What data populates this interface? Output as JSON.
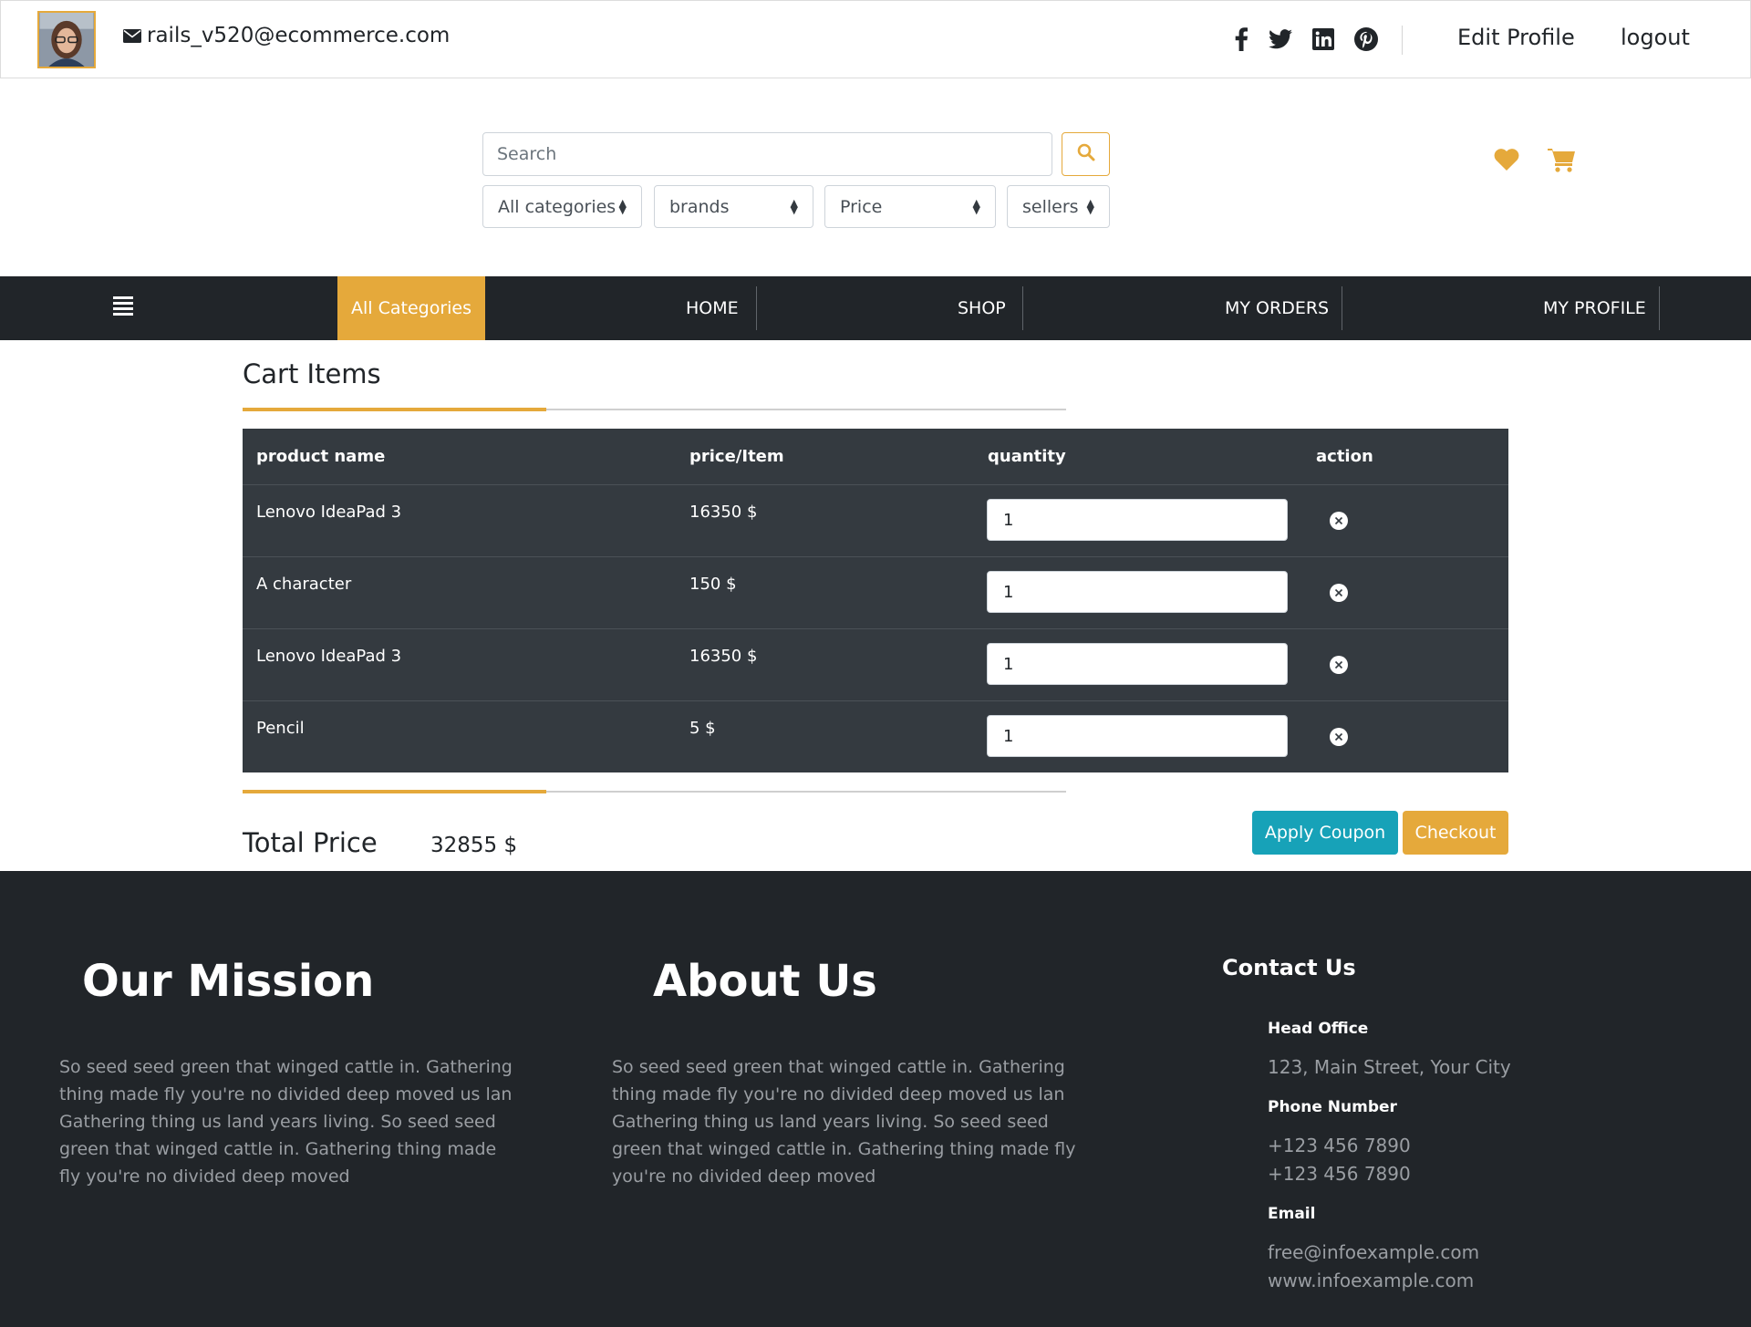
{
  "header": {
    "email": "rails_v520@ecommerce.com",
    "social_icons": [
      "facebook-icon",
      "twitter-icon",
      "linkedin-icon",
      "pinterest-icon"
    ],
    "edit_profile": "Edit Profile",
    "logout": "logout"
  },
  "search": {
    "placeholder": "Search",
    "filters": {
      "category": "All categories",
      "brand": "brands",
      "price": "Price",
      "seller": "sellers"
    }
  },
  "nav": {
    "all_categories": "All Categories",
    "items": [
      "HOME",
      "SHOP",
      "MY ORDERS",
      "MY PROFILE"
    ]
  },
  "cart": {
    "title": "Cart Items",
    "columns": [
      "product name",
      "price/Item",
      "quantity",
      "action"
    ],
    "rows": [
      {
        "name": "Lenovo IdeaPad 3",
        "price": "16350 $",
        "quantity": "1"
      },
      {
        "name": "A character",
        "price": "150 $",
        "quantity": "1"
      },
      {
        "name": "Lenovo IdeaPad 3",
        "price": "16350 $",
        "quantity": "1"
      },
      {
        "name": "Pencil",
        "price": "5 $",
        "quantity": "1"
      }
    ],
    "total_label": "Total Price",
    "total_value": "32855 $",
    "apply_coupon": "Apply Coupon",
    "checkout": "Checkout"
  },
  "footer": {
    "mission_title": "Our Mission",
    "mission_text": "So seed seed green that winged cattle in. Gathering thing made fly you're no divided deep moved us lan Gathering thing us land years living. So seed seed green that winged cattle in. Gathering thing made fly you're no divided deep moved",
    "about_title": "About Us",
    "about_text": "So seed seed green that winged cattle in. Gathering thing made fly you're no divided deep moved us lan Gathering thing us land years living. So seed seed green that winged cattle in. Gathering thing made fly you're no divided deep moved",
    "contact_title": "Contact Us",
    "head_office_label": "Head Office",
    "head_office": "123, Main Street, Your City",
    "phone_label": "Phone Number",
    "phones": [
      "+123 456 7890",
      "+123 456 7890"
    ],
    "email_label": "Email",
    "emails": [
      "free@infoexample.com",
      "www.infoexample.com"
    ]
  },
  "colors": {
    "accent": "#e5a93b",
    "dark": "#212529",
    "table": "#343a40",
    "info": "#17a2b8"
  }
}
